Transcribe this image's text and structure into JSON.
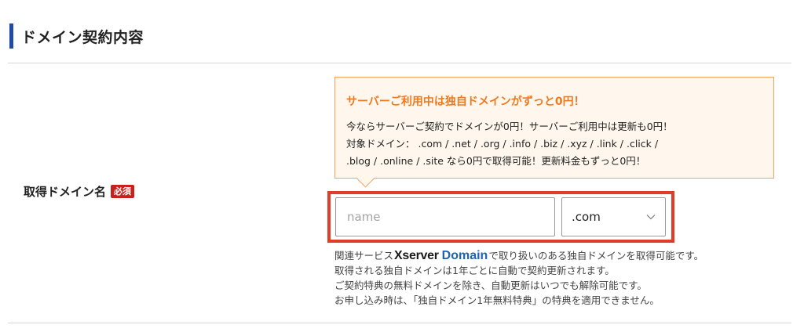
{
  "section": {
    "title": "ドメイン契約内容"
  },
  "field": {
    "label": "取得ドメイン名",
    "required_badge": "必須"
  },
  "promo": {
    "title": "サーバーご利用中は独自ドメインがずっと0円！",
    "lines": [
      "今ならサーバーご契約でドメインが0円！サーバーご利用中は更新も0円！",
      "対象ドメイン： .com / .net / .org / .info / .biz / .xyz / .link / .click /",
      ".blog / .online / .site なら0円で取得可能！更新料金もずっと0円！"
    ]
  },
  "domain_input": {
    "placeholder": "name",
    "value": ""
  },
  "tld_select": {
    "selected": ".com"
  },
  "notes": {
    "line1_prefix": "関連サービス",
    "logo_word1": "Xserver",
    "logo_word2": "Domain",
    "line1_suffix": "で取り扱いのある独自ドメインを取得可能です。",
    "lines": [
      "取得される独自ドメインは1年ごとに自動で契約更新されます。",
      "ご契約特典の無料ドメインを除き、自動更新はいつでも解除可能です。",
      "お申し込み時は、「独自ドメイン1年無料特典」の特典を適用できません。"
    ]
  },
  "colors": {
    "accent_bar": "#1f4aa8",
    "required_badge": "#c8201c",
    "promo_title": "#ee7a1f",
    "promo_border": "#f0a45a",
    "highlight_frame": "#e03c2a",
    "logo_domain": "#1f63b5"
  },
  "icons": {
    "select_chevron": "chevron-down-icon"
  }
}
